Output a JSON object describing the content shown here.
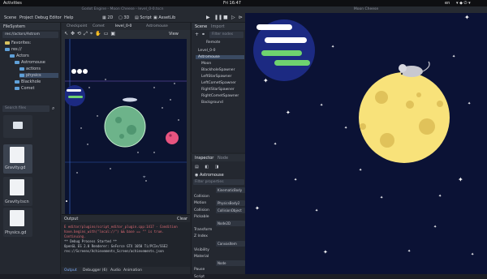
{
  "topbar": {
    "activities": "Activities",
    "clock": "Fri 16:47",
    "lang": "en",
    "indicators": "▾ ◆ ⏻ ▾"
  },
  "editor": {
    "title": "Godot Engine - Moon Cheese - level_0-0.tscn",
    "menu": [
      "Scene",
      "Project",
      "Debug",
      "Editor",
      "Help"
    ],
    "workspaces": [
      "2D",
      "3D",
      "Script",
      "AssetLib"
    ],
    "filesystem": {
      "tab": "FileSystem",
      "path": "res://actors/Astrom",
      "tree": [
        {
          "label": "Favorites:"
        },
        {
          "label": "res://"
        },
        {
          "label": "Actors"
        },
        {
          "label": "Astromouse"
        },
        {
          "label": "actions"
        },
        {
          "label": "physics"
        },
        {
          "label": "Blackhole"
        },
        {
          "label": "Comet"
        }
      ],
      "search_placeholder": "Search files",
      "files": [
        {
          "name": "Gravity.gd"
        },
        {
          "name": "Gravity.tscn"
        },
        {
          "name": "Physics.gd"
        }
      ]
    },
    "viewport": {
      "tabs": [
        "Checkpoint",
        "Comet",
        "level_0-0",
        "Astromouse"
      ],
      "view_label": "View"
    },
    "output": {
      "title": "Output",
      "clear": "Clear",
      "lines": [
        {
          "text": "E editor/plugins/script_editor_plugin.cpp:1417 - Condition",
          "color": "#e06c75"
        },
        {
          "text": "  have.begins_with(\"local://\") && base == \"\" is true.",
          "color": "#e06c75"
        },
        {
          "text": "  Continuing.",
          "color": "#e06c75"
        },
        {
          "text": "** Debug Process Started **",
          "color": "#c8ccd4"
        },
        {
          "text": "OpenGL ES 2.0 Renderer: GeForce GTX 1050 Ti/PCIe/SSE2",
          "color": "#c8ccd4"
        },
        {
          "text": "res://Screens/Achievements_Screen/achievements.json",
          "color": "#c8ccd4"
        }
      ],
      "tabs": [
        "Output",
        "Debugger (6)",
        "Audio",
        "Animation"
      ]
    },
    "scene": {
      "tabs": [
        "Scene",
        "Import"
      ],
      "filter_placeholder": "Filter nodes",
      "remote": "Remote",
      "nodes": [
        {
          "label": "Level_0-0"
        },
        {
          "label": "Astromouse"
        },
        {
          "label": "Moon"
        },
        {
          "label": "BlackholeSpawner"
        },
        {
          "label": "LeftStarSpawner"
        },
        {
          "label": "LeftCometSpawner"
        },
        {
          "label": "RightStarSpawner"
        },
        {
          "label": "RightCometSpawner"
        },
        {
          "label": "Background"
        }
      ]
    },
    "inspector": {
      "tabs": [
        "Inspector",
        "Node"
      ],
      "node": "Astromouse",
      "filter_placeholder": "Filter properties",
      "rows": [
        {
          "label": "",
          "value": "KinematicBody"
        },
        {
          "label": "Collision",
          "value": ""
        },
        {
          "label": "Motion",
          "value": "PhysicsBody2"
        },
        {
          "label": "Collision",
          "value": "CollisionObject"
        },
        {
          "label": "Pickable",
          "value": ""
        },
        {
          "label": "",
          "value": "Node2D"
        },
        {
          "label": "Transform",
          "value": ""
        },
        {
          "label": "Z Index",
          "value": ""
        },
        {
          "label": "",
          "value": "CanvasItem"
        },
        {
          "label": "Visibility",
          "value": ""
        },
        {
          "label": "Material",
          "value": ""
        },
        {
          "label": "",
          "value": "Node"
        },
        {
          "label": "Pause",
          "value": ""
        },
        {
          "label": "Script",
          "value": ""
        }
      ]
    }
  },
  "game": {
    "title": "Moon Cheese"
  },
  "colors": {
    "space": "#0b1235",
    "cheese": "#f8e27a",
    "alien_planet": "#6db38a",
    "pink_planet": "#e75480",
    "nebula": "#1c2a82"
  }
}
